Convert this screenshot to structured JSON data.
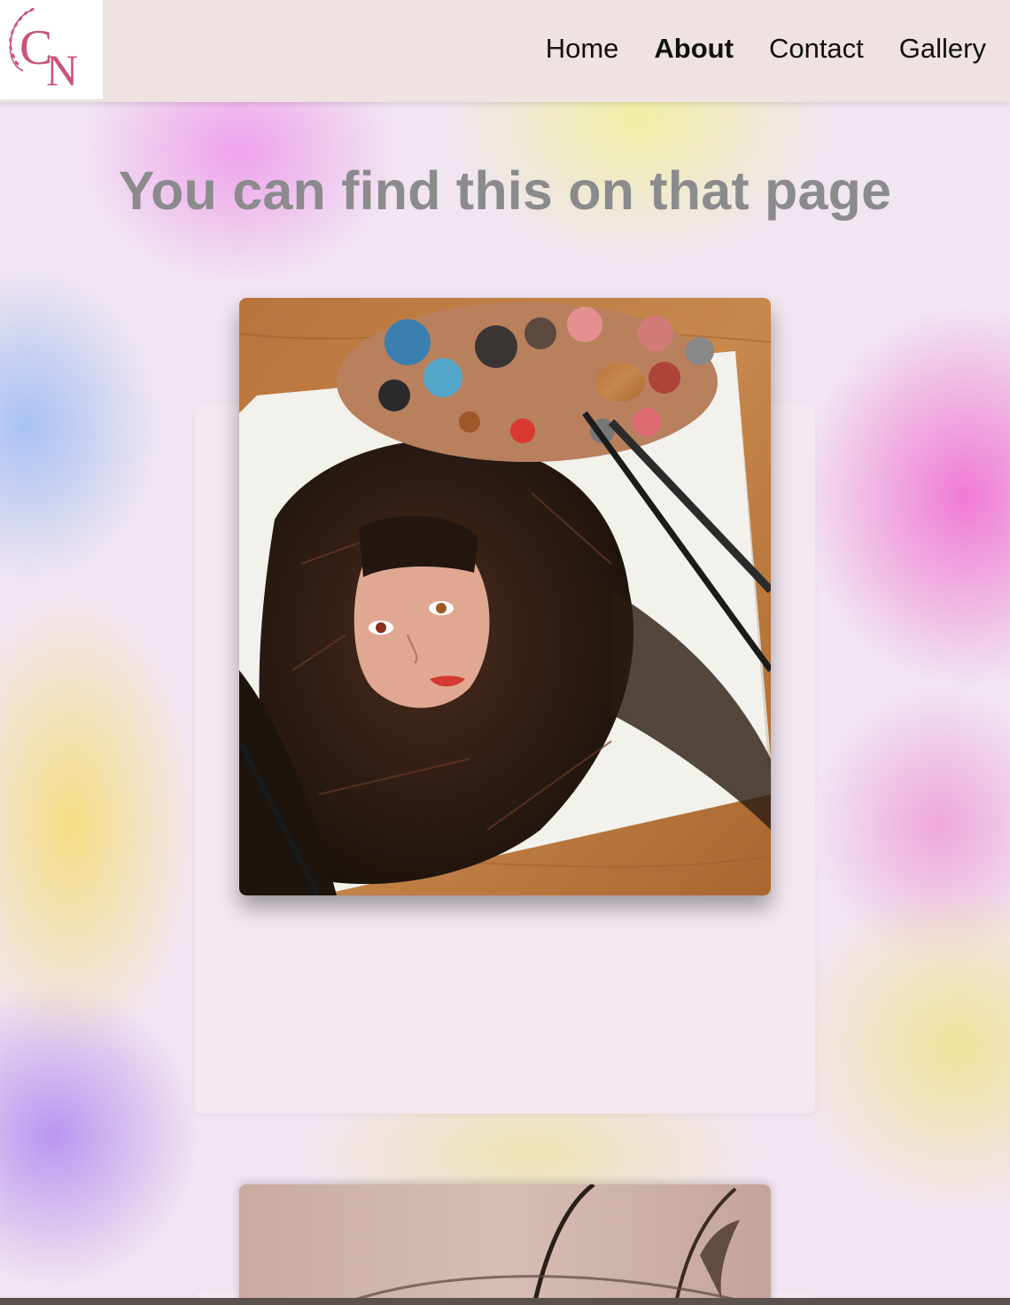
{
  "header": {
    "logo_text": "CN",
    "nav": [
      {
        "label": "Home",
        "active": false
      },
      {
        "label": "About",
        "active": true
      },
      {
        "label": "Contact",
        "active": false
      },
      {
        "label": "Gallery",
        "active": false
      }
    ]
  },
  "main": {
    "headline": "You can find this on that page",
    "artworks": [
      {
        "subject": "painting-portrait-woman-with-palette-icon"
      },
      {
        "subject": "charcoal-sketch-eye-icon"
      }
    ]
  },
  "colors": {
    "logo_pink": "#c9537a",
    "headline_gray": "#8b8b8d",
    "header_bg": "#efe3e1"
  }
}
